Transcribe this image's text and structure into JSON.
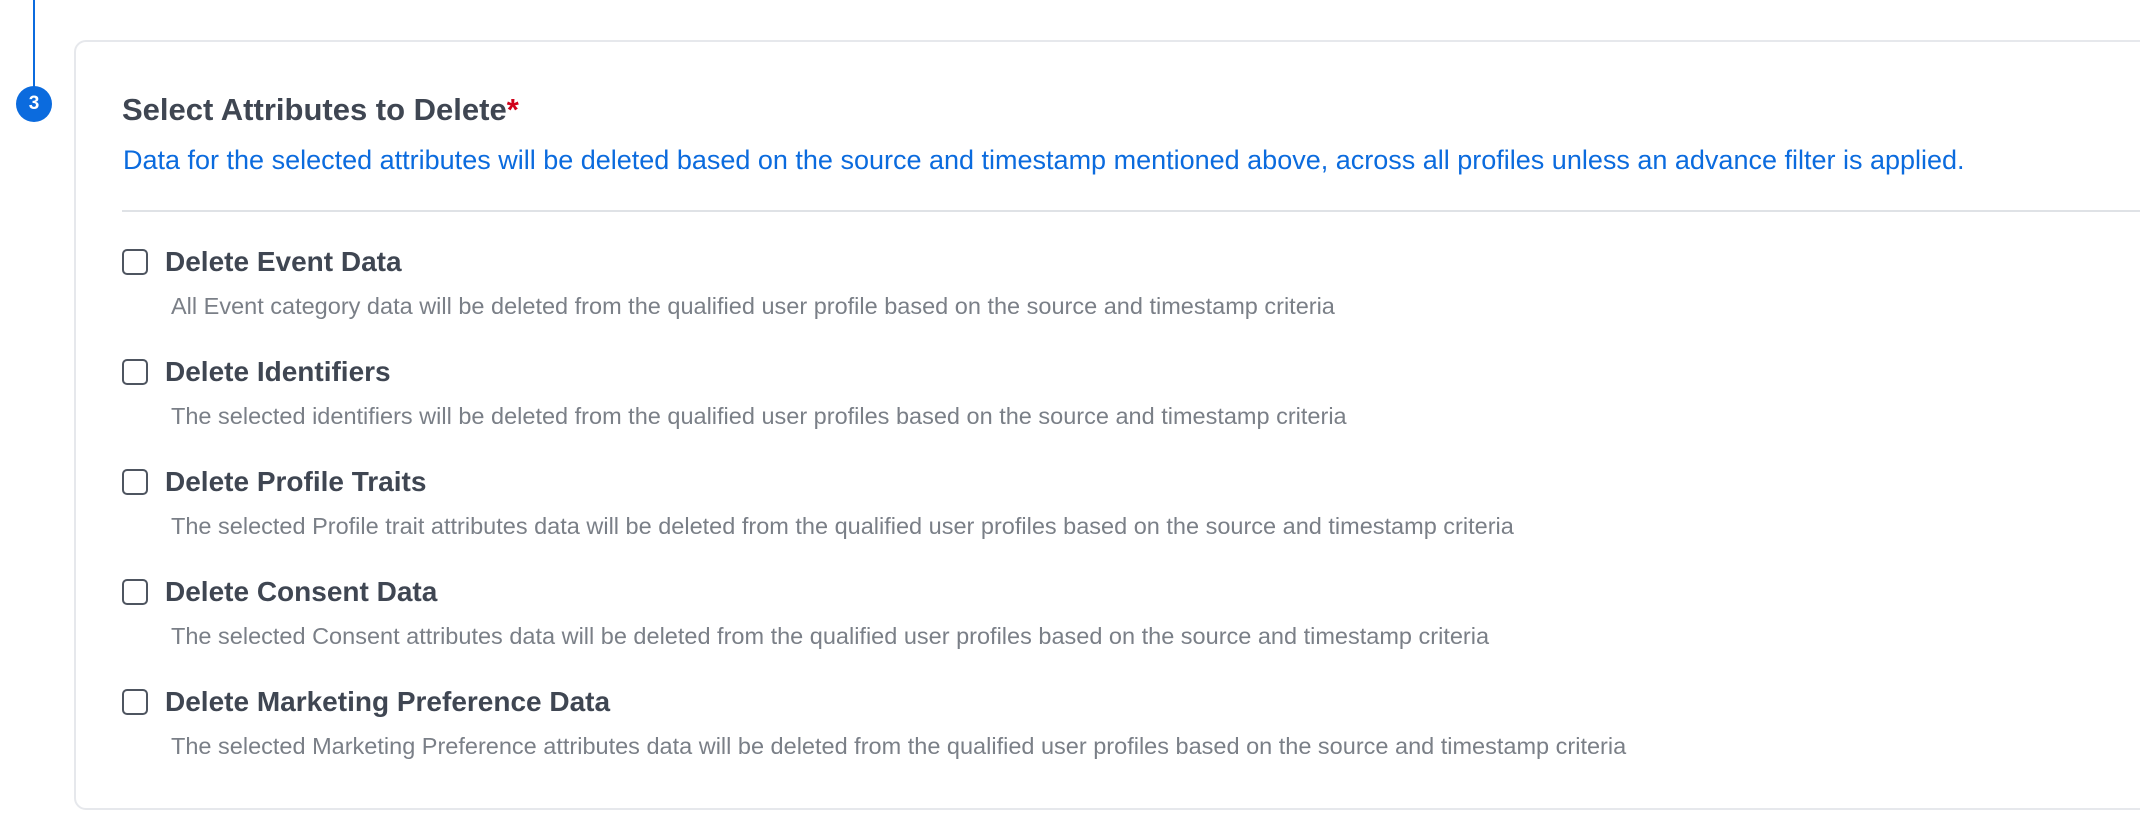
{
  "step": {
    "number": "3"
  },
  "section": {
    "title": "Select Attributes to Delete",
    "required_marker": "*",
    "description": "Data for the selected attributes will be deleted based on the source and timestamp mentioned above, across all profiles unless an advance filter is applied."
  },
  "options": [
    {
      "label": "Delete Event Data",
      "description": "All Event category data will be deleted from the qualified user profile based on the source and timestamp criteria",
      "checked": false
    },
    {
      "label": "Delete Identifiers",
      "description": "The selected identifiers will be deleted from the qualified user profiles based on the source and timestamp criteria",
      "checked": false
    },
    {
      "label": "Delete Profile Traits",
      "description": "The selected Profile trait attributes data will be deleted from the qualified user profiles based on the source and timestamp criteria",
      "checked": false
    },
    {
      "label": "Delete Consent Data",
      "description": "The selected Consent attributes data will be deleted from the qualified user profiles based on the source and timestamp criteria",
      "checked": false
    },
    {
      "label": "Delete Marketing Preference Data",
      "description": "The selected Marketing Preference attributes data will be deleted from the qualified user profiles based on the source and timestamp criteria",
      "checked": false
    }
  ],
  "colors": {
    "accent": "#0b6bde",
    "required": "#d0021b",
    "heading_text": "#3f4652",
    "muted_text": "#7a7f87",
    "border": "#e6e8ec"
  }
}
